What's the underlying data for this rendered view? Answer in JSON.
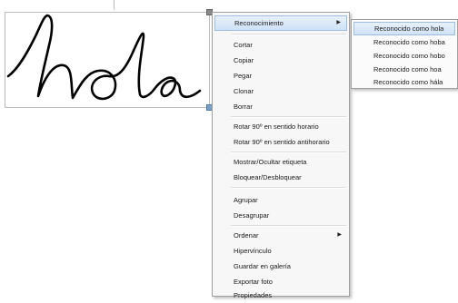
{
  "context_menu": {
    "items": [
      {
        "label": "Reconocimiento",
        "has_submenu": true
      },
      {
        "label": "Cortar"
      },
      {
        "label": "Copiar"
      },
      {
        "label": "Pegar"
      },
      {
        "label": "Clonar"
      },
      {
        "label": "Borrar"
      },
      {
        "label": "Rotar 90º en sentido horario"
      },
      {
        "label": "Rotar 90º en sentido antihorario"
      },
      {
        "label": "Mostrar/Ocultar etiqueta"
      },
      {
        "label": "Bloquear/Desbloquear"
      },
      {
        "label": "Agrupar"
      },
      {
        "label": "Desagrupar"
      },
      {
        "label": "Ordenar",
        "has_submenu": true
      },
      {
        "label": "Hipervínculo"
      },
      {
        "label": "Guardar en galería"
      },
      {
        "label": "Exportar foto"
      },
      {
        "label": "Propiedades"
      }
    ],
    "arrow_glyph": "▶"
  },
  "recognition_submenu": {
    "items": [
      {
        "label": "Reconocido como hola"
      },
      {
        "label": "Reconocido como hoba"
      },
      {
        "label": "Reconocido como hobo"
      },
      {
        "label": "Reconocido como hoa"
      },
      {
        "label": "Reconocido como hála"
      }
    ]
  },
  "colors": {
    "highlight": "#cfe2f7",
    "ink": "#000000"
  }
}
